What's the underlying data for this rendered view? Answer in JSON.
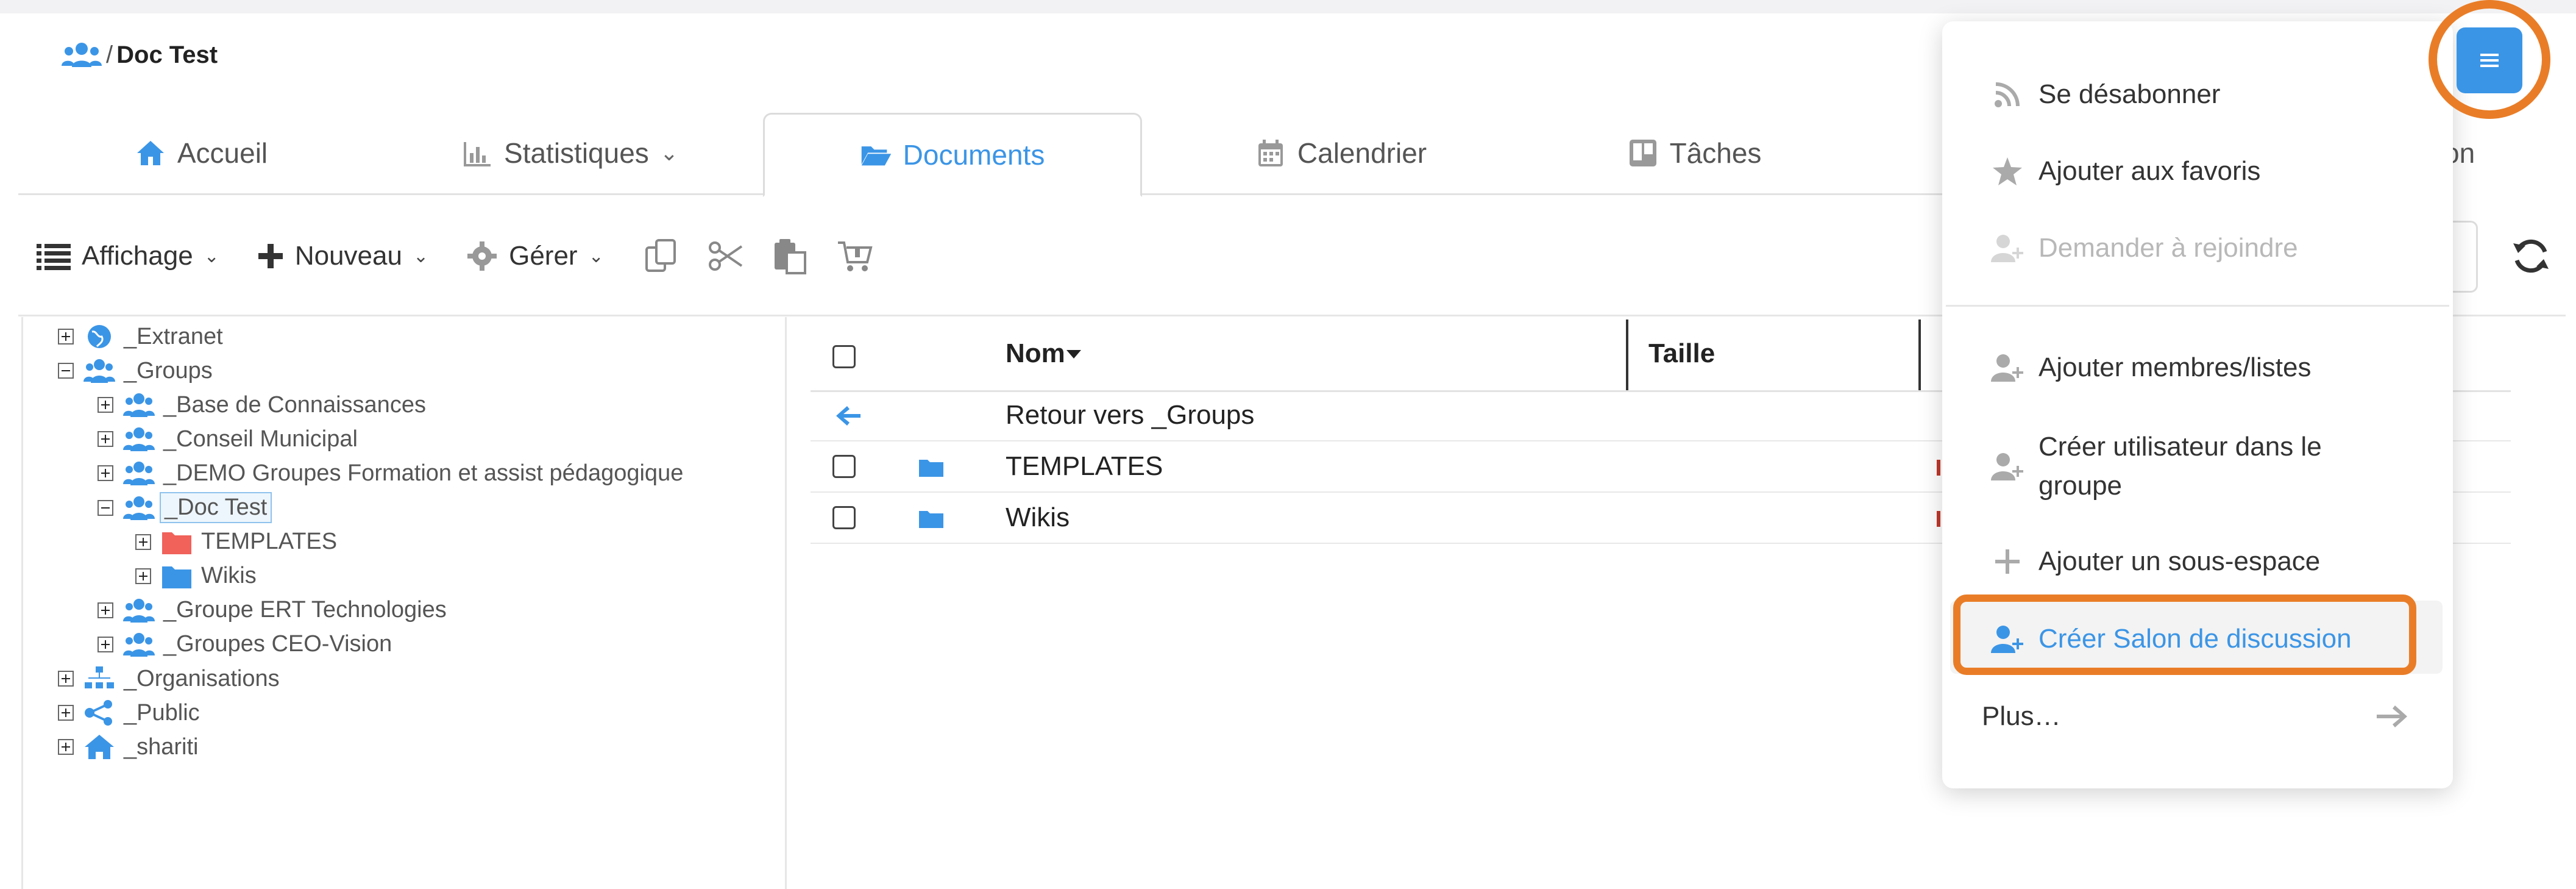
{
  "breadcrumb": {
    "separator": "/",
    "title": "Doc Test"
  },
  "tabs": [
    {
      "label": "Accueil",
      "icon": "home-icon"
    },
    {
      "label": "Statistiques",
      "icon": "bar-chart-icon",
      "chevron": "⌄"
    },
    {
      "label": "Documents",
      "icon": "folder-open-icon",
      "active": true
    },
    {
      "label": "Calendrier",
      "icon": "calendar-icon"
    },
    {
      "label": "Tâches",
      "icon": "kanban-icon"
    },
    {
      "label_partial_right": "on"
    }
  ],
  "toolbar": {
    "display_label": "Affichage",
    "new_label": "Nouveau",
    "manage_label": "Gérer",
    "icons": [
      "copy-icon",
      "cut-icon",
      "paste-icon",
      "cart-icon"
    ]
  },
  "tree": [
    {
      "label": "_Extranet",
      "icon": "globe-icon",
      "level": 0,
      "expanded": false
    },
    {
      "label": "_Groups",
      "icon": "users-icon",
      "level": 0,
      "expanded": true
    },
    {
      "label": "_Base de Connaissances",
      "icon": "users-icon",
      "level": 1,
      "expanded": false
    },
    {
      "label": "_Conseil Municipal",
      "icon": "users-icon",
      "level": 1,
      "expanded": false
    },
    {
      "label": "_DEMO Groupes Formation et assist pédagogique",
      "icon": "users-icon",
      "level": 1,
      "expanded": false
    },
    {
      "label": "_Doc Test",
      "icon": "users-icon",
      "level": 1,
      "expanded": true,
      "selected": true
    },
    {
      "label": "TEMPLATES",
      "icon": "folder-icon",
      "level": 2,
      "expanded": false,
      "color": "#f0625a"
    },
    {
      "label": "Wikis",
      "icon": "folder-icon",
      "level": 2,
      "expanded": false,
      "color": "#3b95e6"
    },
    {
      "label": "_Groupe ERT Technologies",
      "icon": "users-icon",
      "level": 1,
      "expanded": false
    },
    {
      "label": "_Groupes CEO-Vision",
      "icon": "users-icon",
      "level": 1,
      "expanded": false
    },
    {
      "label": "_Organisations",
      "icon": "org-chart-icon",
      "level": 0,
      "expanded": false
    },
    {
      "label": "_Public",
      "icon": "share-icon",
      "level": 0,
      "expanded": false
    },
    {
      "label": "_shariti",
      "icon": "home-icon",
      "level": 0,
      "expanded": false
    }
  ],
  "table": {
    "columns": {
      "name": "Nom",
      "size": "Taille"
    },
    "back_label": "Retour vers _Groups",
    "rows": [
      {
        "name": "TEMPLATES"
      },
      {
        "name": "Wikis"
      }
    ]
  },
  "menu": {
    "items": [
      {
        "label": "Se désabonner",
        "icon": "rss-icon",
        "state": "normal"
      },
      {
        "label": "Ajouter aux favoris",
        "icon": "star-icon",
        "state": "normal"
      },
      {
        "label": "Demander à rejoindre",
        "icon": "user-plus-icon",
        "state": "disabled"
      },
      {
        "label": "Ajouter membres/listes",
        "icon": "user-plus-icon",
        "state": "normal"
      },
      {
        "label_line1": "Créer utilisateur dans le",
        "label_line2": "groupe",
        "icon": "user-plus-icon",
        "state": "normal"
      },
      {
        "label": "Ajouter un sous-espace",
        "icon": "plus-icon",
        "state": "normal"
      },
      {
        "label": "Créer Salon de discussion",
        "icon": "user-plus-icon",
        "state": "highlighted"
      },
      {
        "label": "Plus…",
        "icon": "arrow-right-icon",
        "state": "normal"
      }
    ]
  },
  "colors": {
    "accent": "#3b95e6",
    "annotation": "#e97d27",
    "templates_folder": "#f0625a"
  }
}
